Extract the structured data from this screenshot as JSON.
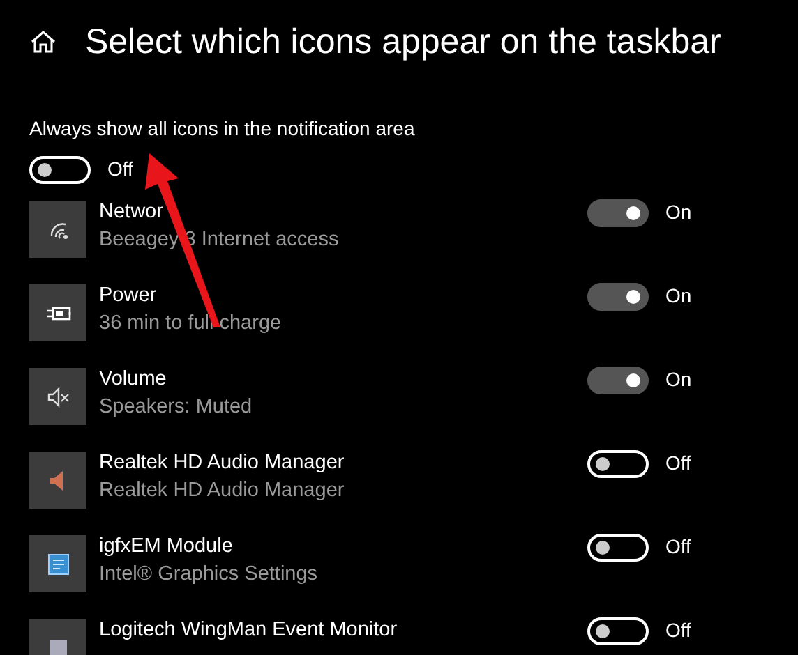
{
  "title": "Select which icons appear on the taskbar",
  "always_show": {
    "label": "Always show all icons in the notification area",
    "on": false,
    "state_text": "Off"
  },
  "items": [
    {
      "name": "Networ",
      "detail": "Beeagey 3 Internet access",
      "on": true,
      "state_text": "On"
    },
    {
      "name": "Power",
      "detail": "36 min to full charge",
      "on": true,
      "state_text": "On"
    },
    {
      "name": "Volume",
      "detail": "Speakers: Muted",
      "on": true,
      "state_text": "On"
    },
    {
      "name": "Realtek HD Audio Manager",
      "detail": "Realtek HD Audio Manager",
      "on": false,
      "state_text": "Off"
    },
    {
      "name": "igfxEM Module",
      "detail": "Intel® Graphics Settings",
      "on": false,
      "state_text": "Off"
    },
    {
      "name": "Logitech WingMan Event Monitor",
      "on": false,
      "state_text": "Off"
    }
  ]
}
